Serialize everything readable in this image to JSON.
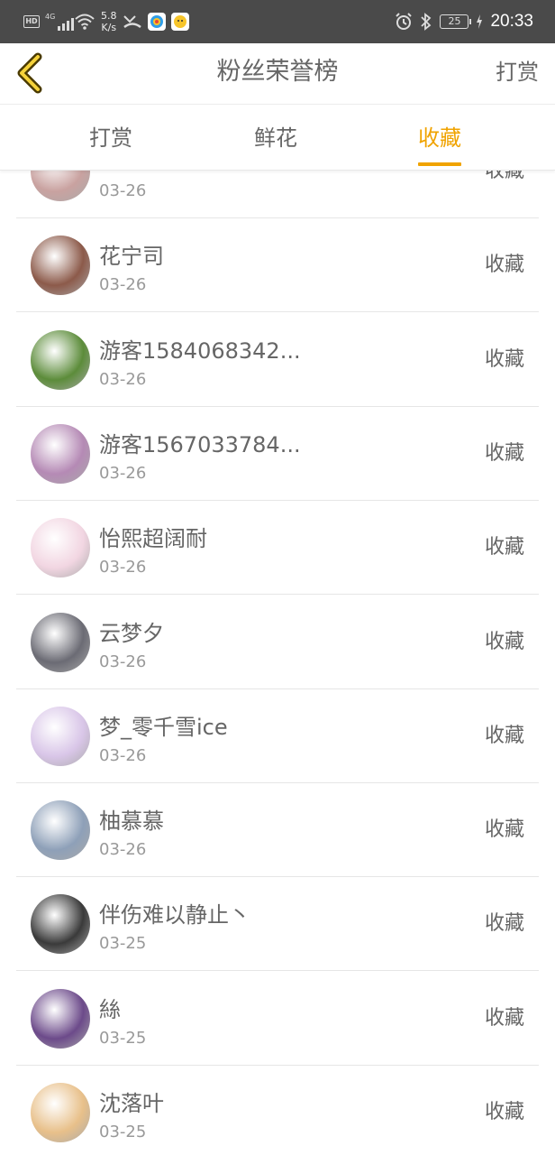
{
  "status_bar": {
    "hd": "HD",
    "network": "4G",
    "speed_value": "5.8",
    "speed_unit": "K/s",
    "battery": "25",
    "time": "20:33"
  },
  "header": {
    "title": "粉丝荣誉榜",
    "action_label": "打赏"
  },
  "tabs": [
    {
      "label": "打赏",
      "active": false
    },
    {
      "label": "鲜花",
      "active": false
    },
    {
      "label": "收藏",
      "active": true
    }
  ],
  "accent_color": "#f0a300",
  "list": [
    {
      "name": "",
      "date": "03-26",
      "action": "收藏",
      "avatar": "#c9a2a0"
    },
    {
      "name": "花宁司",
      "date": "03-26",
      "action": "收藏",
      "avatar": "#8c5a4a"
    },
    {
      "name": "游客1584068342...",
      "date": "03-26",
      "action": "收藏",
      "avatar": "#5c8c3a"
    },
    {
      "name": "游客1567033784...",
      "date": "03-26",
      "action": "收藏",
      "avatar": "#b58ab5"
    },
    {
      "name": "怡熙超阔耐",
      "date": "03-26",
      "action": "收藏",
      "avatar": "#f2d6e2"
    },
    {
      "name": "云梦夕",
      "date": "03-26",
      "action": "收藏",
      "avatar": "#6b6b74"
    },
    {
      "name": "梦_零千雪ice",
      "date": "03-26",
      "action": "收藏",
      "avatar": "#d9c6e8"
    },
    {
      "name": "柚慕慕",
      "date": "03-26",
      "action": "收藏",
      "avatar": "#8ea0b8"
    },
    {
      "name": "伴伤难以静止丶",
      "date": "03-25",
      "action": "收藏",
      "avatar": "#3a3a3a"
    },
    {
      "name": "絲",
      "date": "03-25",
      "action": "收藏",
      "avatar": "#6c4a8a"
    },
    {
      "name": "沈落叶",
      "date": "03-25",
      "action": "收藏",
      "avatar": "#e8c08a"
    }
  ]
}
